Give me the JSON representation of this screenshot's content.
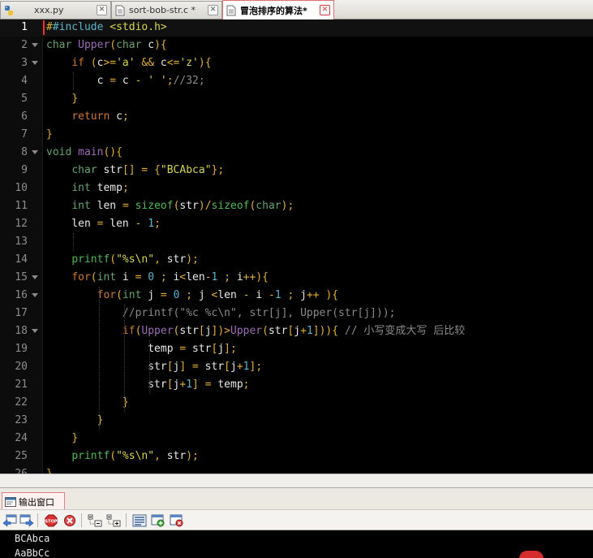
{
  "tabs": [
    {
      "label": "xxx.py",
      "close": "✕",
      "icon": "python-file-icon",
      "active": false
    },
    {
      "label": "sort-bob-str.c *",
      "close": "✕",
      "icon": "document-icon",
      "active": false
    },
    {
      "label": "冒泡排序的算法*",
      "close": "✕",
      "icon": "document-icon",
      "active": true
    }
  ],
  "editor": {
    "current_line": 1,
    "lines": [
      {
        "n": "1",
        "fold": false,
        "segs": [
          [
            "#",
            "op"
          ],
          [
            "#include",
            "pp"
          ],
          [
            " ",
            "id"
          ],
          [
            "<stdio.h>",
            "st"
          ]
        ]
      },
      {
        "n": "2",
        "fold": true,
        "segs": [
          [
            "char",
            "ty"
          ],
          [
            " ",
            "id"
          ],
          [
            "Upper",
            "fn"
          ],
          [
            "(",
            "op"
          ],
          [
            "char",
            "ty"
          ],
          [
            " c",
            "id"
          ],
          [
            ")",
            "op"
          ],
          [
            "{",
            "op"
          ]
        ]
      },
      {
        "n": "3",
        "fold": true,
        "segs": [
          [
            "    ",
            "id"
          ],
          [
            "if",
            "kw"
          ],
          [
            " ",
            "id"
          ],
          [
            "(",
            "op"
          ],
          [
            "c",
            "id"
          ],
          [
            ">=",
            "op"
          ],
          [
            "'a'",
            "st"
          ],
          [
            " ",
            "id"
          ],
          [
            "&&",
            "op"
          ],
          [
            " c",
            "id"
          ],
          [
            "<=",
            "op"
          ],
          [
            "'z'",
            "st"
          ],
          [
            ")",
            "op"
          ],
          [
            "{",
            "op"
          ]
        ]
      },
      {
        "n": "4",
        "fold": false,
        "segs": [
          [
            "        c ",
            "id"
          ],
          [
            "=",
            "op"
          ],
          [
            " c ",
            "id"
          ],
          [
            "-",
            "op"
          ],
          [
            " ",
            "id"
          ],
          [
            "' '",
            "st"
          ],
          [
            ";",
            "op"
          ],
          [
            "//32;",
            "cm"
          ]
        ]
      },
      {
        "n": "5",
        "fold": false,
        "segs": [
          [
            "    ",
            "id"
          ],
          [
            "}",
            "op"
          ]
        ]
      },
      {
        "n": "6",
        "fold": false,
        "segs": [
          [
            "    ",
            "id"
          ],
          [
            "return",
            "kw"
          ],
          [
            " c",
            "id"
          ],
          [
            ";",
            "op"
          ]
        ]
      },
      {
        "n": "7",
        "fold": false,
        "segs": [
          [
            "}",
            "op"
          ]
        ]
      },
      {
        "n": "8",
        "fold": true,
        "segs": [
          [
            "void",
            "ty"
          ],
          [
            " ",
            "id"
          ],
          [
            "main",
            "fn"
          ],
          [
            "()",
            "op"
          ],
          [
            "{",
            "op"
          ]
        ]
      },
      {
        "n": "9",
        "fold": false,
        "segs": [
          [
            "    ",
            "id"
          ],
          [
            "char",
            "ty"
          ],
          [
            " str",
            "id"
          ],
          [
            "[]",
            "op"
          ],
          [
            " ",
            "id"
          ],
          [
            "=",
            "op"
          ],
          [
            " ",
            "id"
          ],
          [
            "{",
            "op"
          ],
          [
            "\"BCAbca\"",
            "st"
          ],
          [
            "}",
            "op"
          ],
          [
            ";",
            "op"
          ]
        ]
      },
      {
        "n": "10",
        "fold": false,
        "segs": [
          [
            "    ",
            "id"
          ],
          [
            "int",
            "ty"
          ],
          [
            " temp",
            "id"
          ],
          [
            ";",
            "op"
          ]
        ]
      },
      {
        "n": "11",
        "fold": false,
        "segs": [
          [
            "    ",
            "id"
          ],
          [
            "int",
            "ty"
          ],
          [
            " len ",
            "id"
          ],
          [
            "=",
            "op"
          ],
          [
            " ",
            "id"
          ],
          [
            "sizeof",
            "fc"
          ],
          [
            "(",
            "op"
          ],
          [
            "str",
            "id"
          ],
          [
            ")",
            "op"
          ],
          [
            "/",
            "op"
          ],
          [
            "sizeof",
            "fc"
          ],
          [
            "(",
            "op"
          ],
          [
            "char",
            "ty"
          ],
          [
            ")",
            "op"
          ],
          [
            ";",
            "op"
          ]
        ]
      },
      {
        "n": "12",
        "fold": false,
        "segs": [
          [
            "    len ",
            "id"
          ],
          [
            "=",
            "op"
          ],
          [
            " len ",
            "id"
          ],
          [
            "-",
            "op"
          ],
          [
            " ",
            "id"
          ],
          [
            "1",
            "nm"
          ],
          [
            ";",
            "op"
          ]
        ]
      },
      {
        "n": "13",
        "fold": false,
        "segs": [
          [
            "",
            "id"
          ]
        ]
      },
      {
        "n": "14",
        "fold": false,
        "segs": [
          [
            "    ",
            "id"
          ],
          [
            "printf",
            "fc"
          ],
          [
            "(",
            "op"
          ],
          [
            "\"%s\\n\"",
            "st"
          ],
          [
            ",",
            "op"
          ],
          [
            " str",
            "id"
          ],
          [
            ")",
            "op"
          ],
          [
            ";",
            "op"
          ]
        ]
      },
      {
        "n": "15",
        "fold": true,
        "segs": [
          [
            "    ",
            "id"
          ],
          [
            "for",
            "kw"
          ],
          [
            "(",
            "op"
          ],
          [
            "int",
            "ty"
          ],
          [
            " i ",
            "id"
          ],
          [
            "=",
            "op"
          ],
          [
            " ",
            "id"
          ],
          [
            "0",
            "nm"
          ],
          [
            " ",
            "id"
          ],
          [
            ";",
            "op"
          ],
          [
            " i",
            "id"
          ],
          [
            "<",
            "op"
          ],
          [
            "len",
            "id"
          ],
          [
            "-",
            "op"
          ],
          [
            "1",
            "nm"
          ],
          [
            " ",
            "id"
          ],
          [
            ";",
            "op"
          ],
          [
            " i",
            "id"
          ],
          [
            "++",
            "op"
          ],
          [
            ")",
            "op"
          ],
          [
            "{",
            "op"
          ]
        ]
      },
      {
        "n": "16",
        "fold": true,
        "segs": [
          [
            "        ",
            "id"
          ],
          [
            "for",
            "kw"
          ],
          [
            "(",
            "op"
          ],
          [
            "int",
            "ty"
          ],
          [
            " j ",
            "id"
          ],
          [
            "=",
            "op"
          ],
          [
            " ",
            "id"
          ],
          [
            "0",
            "nm"
          ],
          [
            " ",
            "id"
          ],
          [
            ";",
            "op"
          ],
          [
            " j ",
            "id"
          ],
          [
            "<",
            "op"
          ],
          [
            "len ",
            "id"
          ],
          [
            "-",
            "op"
          ],
          [
            " i ",
            "id"
          ],
          [
            "-",
            "op"
          ],
          [
            "1",
            "nm"
          ],
          [
            " ",
            "id"
          ],
          [
            ";",
            "op"
          ],
          [
            " j",
            "id"
          ],
          [
            "++",
            "op"
          ],
          [
            " ",
            "id"
          ],
          [
            ")",
            "op"
          ],
          [
            "{",
            "op"
          ]
        ]
      },
      {
        "n": "17",
        "fold": false,
        "segs": [
          [
            "            ",
            "id"
          ],
          [
            "//printf(\"%c %c\\n\", str[j], Upper(str[j]));",
            "cm"
          ]
        ]
      },
      {
        "n": "18",
        "fold": true,
        "segs": [
          [
            "            ",
            "id"
          ],
          [
            "if",
            "kw"
          ],
          [
            "(",
            "op"
          ],
          [
            "Upper",
            "fn"
          ],
          [
            "(",
            "op"
          ],
          [
            "str",
            "id"
          ],
          [
            "[",
            "op"
          ],
          [
            "j",
            "id"
          ],
          [
            "])",
            "op"
          ],
          [
            ">",
            "op"
          ],
          [
            "Upper",
            "fn"
          ],
          [
            "(",
            "op"
          ],
          [
            "str",
            "id"
          ],
          [
            "[",
            "op"
          ],
          [
            "j",
            "id"
          ],
          [
            "+",
            "op"
          ],
          [
            "1",
            "nm"
          ],
          [
            "]))",
            "op"
          ],
          [
            "{",
            "op"
          ],
          [
            " ",
            "id"
          ],
          [
            "// 小写变成大写 后比较",
            "cm"
          ]
        ]
      },
      {
        "n": "19",
        "fold": false,
        "segs": [
          [
            "                temp ",
            "id"
          ],
          [
            "=",
            "op"
          ],
          [
            " str",
            "id"
          ],
          [
            "[",
            "op"
          ],
          [
            "j",
            "id"
          ],
          [
            "]",
            "op"
          ],
          [
            ";",
            "op"
          ]
        ]
      },
      {
        "n": "20",
        "fold": false,
        "segs": [
          [
            "                str",
            "id"
          ],
          [
            "[",
            "op"
          ],
          [
            "j",
            "id"
          ],
          [
            "]",
            "op"
          ],
          [
            " ",
            "id"
          ],
          [
            "=",
            "op"
          ],
          [
            " str",
            "id"
          ],
          [
            "[",
            "op"
          ],
          [
            "j",
            "id"
          ],
          [
            "+",
            "op"
          ],
          [
            "1",
            "nm"
          ],
          [
            "]",
            "op"
          ],
          [
            ";",
            "op"
          ]
        ]
      },
      {
        "n": "21",
        "fold": false,
        "segs": [
          [
            "                str",
            "id"
          ],
          [
            "[",
            "op"
          ],
          [
            "j",
            "id"
          ],
          [
            "+",
            "op"
          ],
          [
            "1",
            "nm"
          ],
          [
            "]",
            "op"
          ],
          [
            " ",
            "id"
          ],
          [
            "=",
            "op"
          ],
          [
            " temp",
            "id"
          ],
          [
            ";",
            "op"
          ]
        ]
      },
      {
        "n": "22",
        "fold": false,
        "segs": [
          [
            "            ",
            "id"
          ],
          [
            "}",
            "op"
          ]
        ]
      },
      {
        "n": "23",
        "fold": false,
        "segs": [
          [
            "        ",
            "id"
          ],
          [
            "}",
            "op"
          ]
        ]
      },
      {
        "n": "24",
        "fold": false,
        "segs": [
          [
            "    ",
            "id"
          ],
          [
            "}",
            "op"
          ]
        ]
      },
      {
        "n": "25",
        "fold": false,
        "segs": [
          [
            "    ",
            "id"
          ],
          [
            "printf",
            "fc"
          ],
          [
            "(",
            "op"
          ],
          [
            "\"%s\\n\"",
            "st"
          ],
          [
            ",",
            "op"
          ],
          [
            " str",
            "id"
          ],
          [
            ")",
            "op"
          ],
          [
            ";",
            "op"
          ]
        ]
      },
      {
        "n": "26",
        "fold": false,
        "segs": [
          [
            "}",
            "op"
          ]
        ]
      }
    ]
  },
  "output_panel": {
    "tab_label": "输出窗口",
    "toolbar_buttons": [
      "output-prev-icon",
      "output-next-icon",
      "stop-icon",
      "cancel-icon",
      "collapse-icon",
      "expand-icon",
      "list-view-icon",
      "add-panel-icon",
      "clear-output-icon"
    ]
  },
  "console": {
    "lines": [
      "BCAbca",
      "AaBbCc"
    ]
  }
}
